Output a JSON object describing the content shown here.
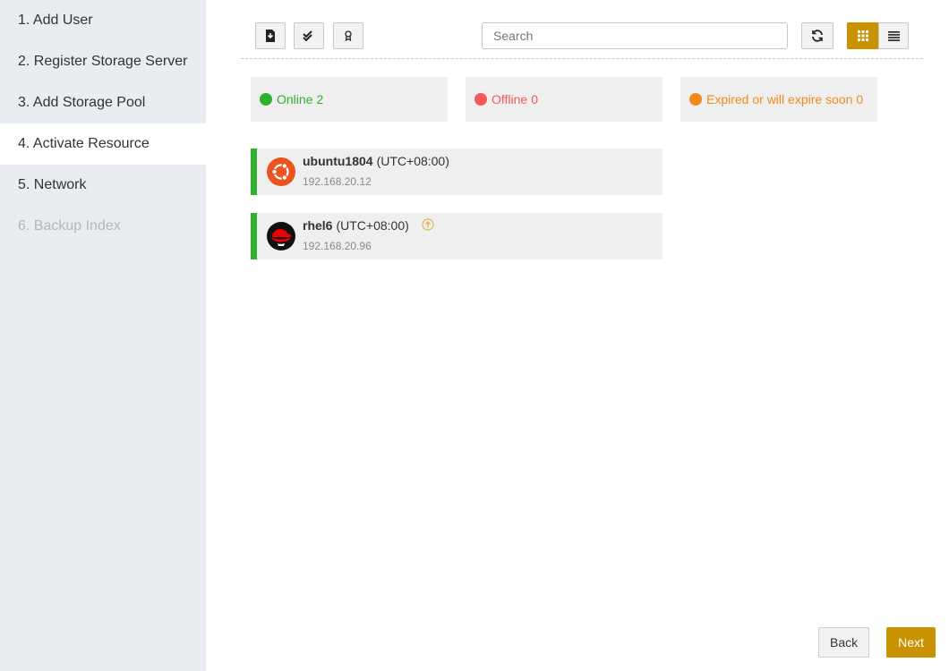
{
  "steps": [
    {
      "label": "1. Add User",
      "state": "normal"
    },
    {
      "label": "2. Register Storage Server",
      "state": "normal"
    },
    {
      "label": "3. Add Storage Pool",
      "state": "normal"
    },
    {
      "label": "4. Activate Resource",
      "state": "active"
    },
    {
      "label": "5. Network",
      "state": "normal"
    },
    {
      "label": "6. Backup Index",
      "state": "disabled"
    }
  ],
  "toolbar": {
    "buttons": [
      "import-icon",
      "batch-select-icon",
      "license-icon"
    ],
    "search_placeholder": "Search",
    "refresh_icon": "refresh-icon",
    "view_modes": [
      "grid-view-icon",
      "list-view-icon"
    ],
    "selected_view": "grid"
  },
  "status": {
    "online": {
      "label": "Online",
      "count": "2",
      "color": "#2fb12f"
    },
    "offline": {
      "label": "Offline",
      "count": "0",
      "color": "#f05a5a"
    },
    "expired": {
      "label": "Expired or will expire soon",
      "count": "0",
      "color": "#f08a1c"
    }
  },
  "resources": [
    {
      "name": "ubuntu1804",
      "timezone": "(UTC+08:00)",
      "ip": "192.168.20.12",
      "os_icon": "ubuntu-icon",
      "status": "online",
      "upgrade_available": false
    },
    {
      "name": "rhel6",
      "timezone": "(UTC+08:00)",
      "ip": "192.168.20.96",
      "os_icon": "redhat-icon",
      "status": "online",
      "upgrade_available": true
    }
  ],
  "footer": {
    "back_label": "Back",
    "next_label": "Next"
  },
  "colors": {
    "accent": "#c99200",
    "online": "#2fb12f",
    "offline": "#f05a5a",
    "warning": "#f08a1c"
  }
}
